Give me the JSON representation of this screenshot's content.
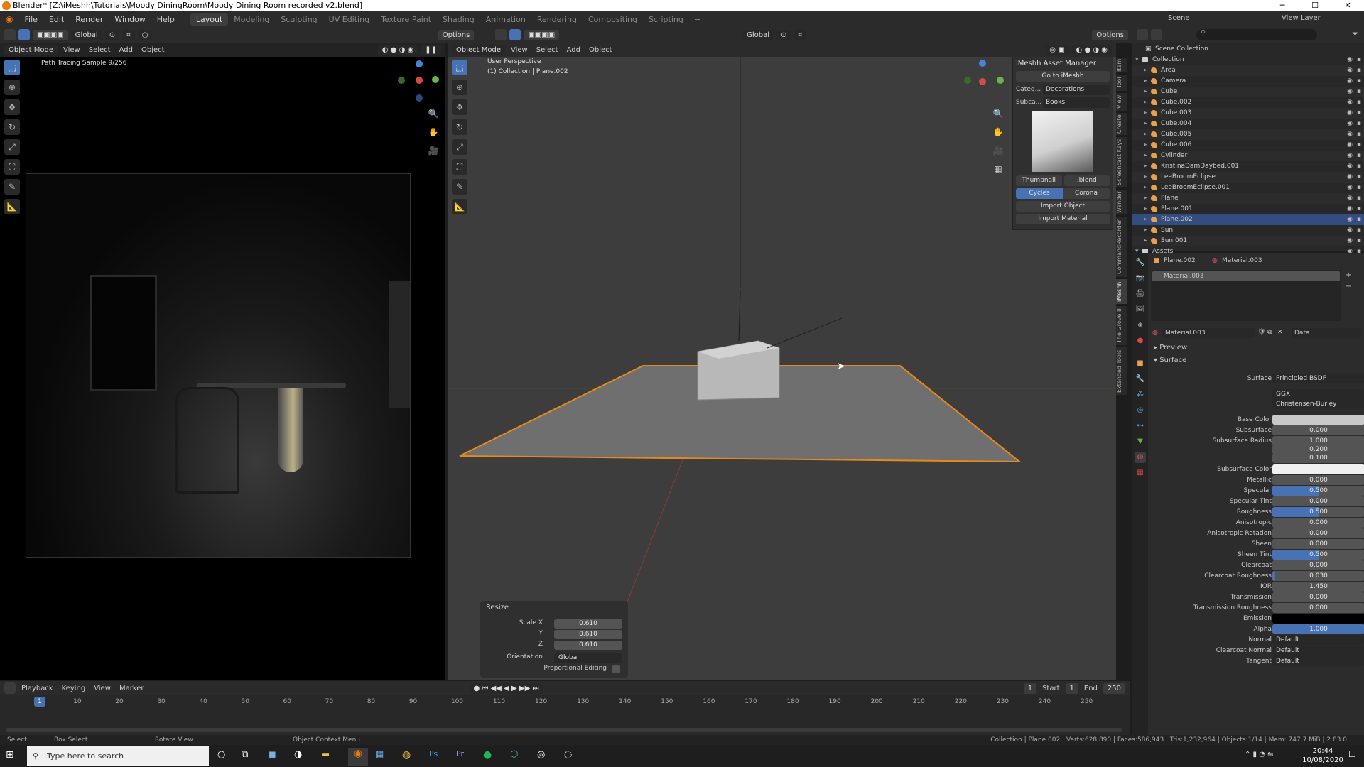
{
  "window": {
    "title": "Blender* [Z:\\iMeshh\\Tutorials\\Moody DiningRoom\\Moody Dining Room recorded v2.blend]",
    "controls": [
      "─",
      "☐",
      "✕"
    ]
  },
  "menu": [
    "File",
    "Edit",
    "Render",
    "Window",
    "Help"
  ],
  "workspaces": [
    "Layout",
    "Modeling",
    "Sculpting",
    "UV Editing",
    "Texture Paint",
    "Shading",
    "Animation",
    "Rendering",
    "Compositing",
    "Scripting",
    "+"
  ],
  "scene": {
    "name": "Scene",
    "view_layer": "View Layer"
  },
  "left_viewport": {
    "mode": "Object Mode",
    "menus": [
      "View",
      "Select",
      "Add",
      "Object"
    ],
    "overlay_text": "Path Tracing Sample 9/256"
  },
  "header_tools": {
    "orientation": "Global",
    "options": "Options"
  },
  "right_viewport": {
    "mode": "Object Mode",
    "menus": [
      "View",
      "Select",
      "Add",
      "Object"
    ],
    "overlay_line1": "User Perspective",
    "overlay_line2": "(1) Collection | Plane.002"
  },
  "imeshh": {
    "title": "iMeshh Asset Manager",
    "goto": "Go to iMeshh",
    "category_label": "Categ...",
    "category_value": "Decorations",
    "subcategory_label": "Subca...",
    "subcategory_value": "Books",
    "thumb_btn": "Thumbnail",
    "blend_btn": ".blend",
    "cycles": "Cycles",
    "corona": "Corona",
    "import_object": "Import Object",
    "import_material": "Import Material"
  },
  "side_tabs": [
    "Item",
    "Tool",
    "View",
    "Create",
    "Screencast Keys",
    "Wander",
    "CommandRecorder",
    "iMeshh",
    "The Grove 8",
    "Extended Tools"
  ],
  "resize_panel": {
    "title": "Resize",
    "scale_x_label": "Scale X",
    "scale_x": "0.610",
    "y_label": "Y",
    "y": "0.610",
    "z_label": "Z",
    "z": "0.610",
    "orientation_label": "Orientation",
    "orientation": "Global",
    "prop_edit_label": "Proportional Editing"
  },
  "timeline": {
    "menus": [
      "Playback",
      "Keying",
      "View",
      "Marker"
    ],
    "current_frame": "1",
    "start_label": "Start",
    "start": "1",
    "end_label": "End",
    "end": "250",
    "ticks": [
      "1",
      "10",
      "20",
      "30",
      "40",
      "50",
      "60",
      "70",
      "80",
      "90",
      "100",
      "110",
      "120",
      "130",
      "140",
      "150",
      "160",
      "170",
      "180",
      "190",
      "200",
      "210",
      "220",
      "230",
      "240",
      "250"
    ]
  },
  "status_bar": {
    "select": "Select",
    "box_select": "Box Select",
    "rotate": "Rotate View",
    "context": "Object Context Menu",
    "stats": "Collection | Plane.002 | Verts:628,890 | Faces:586,943 | Tris:1,232,964 | Objects:1/14 | Mem: 747.7 MiB | 2.83.0"
  },
  "taskbar": {
    "search_placeholder": "Type here to search",
    "time": "20:44",
    "date": "10/08/2020"
  },
  "outliner": {
    "root": "Scene Collection",
    "items": [
      {
        "name": "Collection",
        "indent": 1,
        "color": "#cfcfcf"
      },
      {
        "name": "Area",
        "indent": 2,
        "color": "#e8a050"
      },
      {
        "name": "Camera",
        "indent": 2,
        "color": "#e8a050"
      },
      {
        "name": "Cube",
        "indent": 2,
        "color": "#e8a050"
      },
      {
        "name": "Cube.002",
        "indent": 2,
        "color": "#e8a050"
      },
      {
        "name": "Cube.003",
        "indent": 2,
        "color": "#e8a050"
      },
      {
        "name": "Cube.004",
        "indent": 2,
        "color": "#e8a050"
      },
      {
        "name": "Cube.005",
        "indent": 2,
        "color": "#e8a050"
      },
      {
        "name": "Cube.006",
        "indent": 2,
        "color": "#e8a050"
      },
      {
        "name": "Cylinder",
        "indent": 2,
        "color": "#e8a050"
      },
      {
        "name": "KristinaDamDaybed.001",
        "indent": 2,
        "color": "#e8a050"
      },
      {
        "name": "LeeBroomEclipse",
        "indent": 2,
        "color": "#e8a050"
      },
      {
        "name": "LeeBroomEclipse.001",
        "indent": 2,
        "color": "#e8a050"
      },
      {
        "name": "Plane",
        "indent": 2,
        "color": "#e8a050"
      },
      {
        "name": "Plane.001",
        "indent": 2,
        "color": "#e8a050"
      },
      {
        "name": "Plane.002",
        "indent": 2,
        "color": "#e8a050",
        "selected": true
      },
      {
        "name": "Sun",
        "indent": 2,
        "color": "#e8a050"
      },
      {
        "name": "Sun.001",
        "indent": 2,
        "color": "#e8a050"
      },
      {
        "name": "Assets",
        "indent": 1,
        "color": "#cfcfcf"
      }
    ]
  },
  "properties": {
    "object": "Plane.002",
    "material": "Material.003",
    "slot": "Material.003",
    "link": "Data",
    "preview": "Preview",
    "surface_section": "Surface",
    "rows": [
      {
        "label": "Surface",
        "value": "Principled BSDF",
        "kind": "menu"
      },
      {
        "label": "",
        "value": "GGX",
        "kind": "menu"
      },
      {
        "label": "",
        "value": "Christensen-Burley",
        "kind": "menu"
      },
      {
        "label": "Base Color",
        "value": "",
        "kind": "color",
        "color": "#c9c9c9"
      },
      {
        "label": "Subsurface",
        "value": "0.000",
        "kind": "num",
        "fill": 0
      },
      {
        "label": "Subsurface Radius",
        "value": "1.000",
        "kind": "num",
        "fill": 0
      },
      {
        "label": "",
        "value": "0.200",
        "kind": "num",
        "fill": 0
      },
      {
        "label": "",
        "value": "0.100",
        "kind": "num",
        "fill": 0
      },
      {
        "label": "Subsurface Color",
        "value": "",
        "kind": "color",
        "color": "#f0f0f0"
      },
      {
        "label": "Metallic",
        "value": "0.000",
        "kind": "num",
        "fill": 0
      },
      {
        "label": "Specular",
        "value": "0.500",
        "kind": "num",
        "fill": 0.5
      },
      {
        "label": "Specular Tint",
        "value": "0.000",
        "kind": "num",
        "fill": 0
      },
      {
        "label": "Roughness",
        "value": "0.500",
        "kind": "num",
        "fill": 0.5
      },
      {
        "label": "Anisotropic",
        "value": "0.000",
        "kind": "num",
        "fill": 0
      },
      {
        "label": "Anisotropic Rotation",
        "value": "0.000",
        "kind": "num",
        "fill": 0
      },
      {
        "label": "Sheen",
        "value": "0.000",
        "kind": "num",
        "fill": 0
      },
      {
        "label": "Sheen Tint",
        "value": "0.500",
        "kind": "num",
        "fill": 0.5
      },
      {
        "label": "Clearcoat",
        "value": "0.000",
        "kind": "num",
        "fill": 0
      },
      {
        "label": "Clearcoat Roughness",
        "value": "0.030",
        "kind": "num",
        "fill": 0.03
      },
      {
        "label": "IOR",
        "value": "1.450",
        "kind": "num",
        "fill": 0
      },
      {
        "label": "Transmission",
        "value": "0.000",
        "kind": "num",
        "fill": 0
      },
      {
        "label": "Transmission Roughness",
        "value": "0.000",
        "kind": "num",
        "fill": 0
      },
      {
        "label": "Emission",
        "value": "",
        "kind": "color",
        "color": "#000000"
      },
      {
        "label": "Alpha",
        "value": "1.000",
        "kind": "num",
        "fill": 1
      },
      {
        "label": "Normal",
        "value": "Default",
        "kind": "text"
      },
      {
        "label": "Clearcoat Normal",
        "value": "Default",
        "kind": "text"
      },
      {
        "label": "Tangent",
        "value": "Default",
        "kind": "text"
      }
    ]
  },
  "colors": {
    "accent": "#4772b3",
    "selection": "#e88a1a",
    "blender_orange": "#e87d0d"
  }
}
